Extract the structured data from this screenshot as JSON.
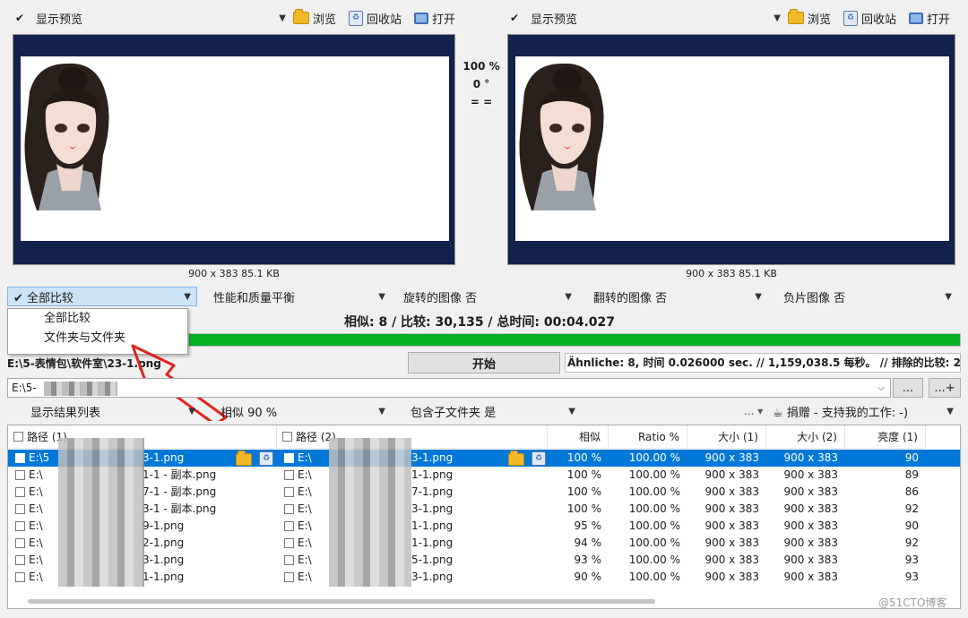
{
  "left_pane": {
    "mode_label": "显示预览",
    "browse_label": "浏览",
    "recycle_label": "回收站",
    "open_label": "打开",
    "caption": "900 x 383 85.1 KB"
  },
  "right_pane": {
    "mode_label": "显示预览",
    "browse_label": "浏览",
    "recycle_label": "回收站",
    "open_label": "打开",
    "caption": "900 x 383 85.1 KB"
  },
  "center_info": {
    "zoom": "100 %",
    "rotation": "0 °",
    "equal": "= ="
  },
  "options_bar": {
    "compare_mode": "全部比较",
    "performance": "性能和质量平衡",
    "rotated": "旋转的图像 否",
    "flipped": "翻转的图像 否",
    "negative": "负片图像 否"
  },
  "compare_menu": {
    "items": [
      "全部比较",
      "文件夹与文件夹"
    ]
  },
  "status": {
    "summary": "相似: 8 / 比较: 30,135 / 总时间: 00:04.027",
    "progress": 1.0
  },
  "action_row": {
    "current_file": "E:\\5-表情包\\软件室\\23-1.png",
    "start_label": "开始",
    "log": "Ähnliche: 8, 时间 0.026000 sec. // 1,159,038.5 每秒。 // 排除的比较: 2"
  },
  "path_bar": {
    "value": "E:\\5-",
    "btn1": "...",
    "btn2": "...+"
  },
  "results_bar": {
    "view": "显示结果列表",
    "similarity": "相似 90 %",
    "subfolders": "包含子文件夹 是",
    "more": "...",
    "donate": "捐赠 - 支持我的工作: -)"
  },
  "table": {
    "headers": [
      "路径 (1)",
      "路径 (2)",
      "相似",
      "Ratio %",
      "大小 (1)",
      "大小 (2)",
      "亮度 (1)"
    ],
    "rows": [
      {
        "p1": "E:\\5",
        "p1s": "3-1.png",
        "p2": "E:\\",
        "p2s": "3-1.png",
        "sim": "100 %",
        "ratio": "100.00 %",
        "s1": "900 x 383",
        "s2": "900 x 383",
        "bright": "90"
      },
      {
        "p1": "E:\\",
        "p1s": "1-1 - 副本.png",
        "p2": "E:\\",
        "p2s": "1-1.png",
        "sim": "100 %",
        "ratio": "100.00 %",
        "s1": "900 x 383",
        "s2": "900 x 383",
        "bright": "89"
      },
      {
        "p1": "E:\\",
        "p1s": "7-1 - 副本.png",
        "p2": "E:\\",
        "p2s": "7-1.png",
        "sim": "100 %",
        "ratio": "100.00 %",
        "s1": "900 x 383",
        "s2": "900 x 383",
        "bright": "86"
      },
      {
        "p1": "E:\\",
        "p1s": "3-1 - 副本.png",
        "p2": "E:\\",
        "p2s": "3-1.png",
        "sim": "100 %",
        "ratio": "100.00 %",
        "s1": "900 x 383",
        "s2": "900 x 383",
        "bright": "92"
      },
      {
        "p1": "E:\\",
        "p1s": "9-1.png",
        "p2": "E:\\",
        "p2s": "1-1.png",
        "sim": "95 %",
        "ratio": "100.00 %",
        "s1": "900 x 383",
        "s2": "900 x 383",
        "bright": "90"
      },
      {
        "p1": "E:\\",
        "p1s": "2-1.png",
        "p2": "E:\\",
        "p2s": "1-1.png",
        "sim": "94 %",
        "ratio": "100.00 %",
        "s1": "900 x 383",
        "s2": "900 x 383",
        "bright": "92"
      },
      {
        "p1": "E:\\",
        "p1s": "3-1.png",
        "p2": "E:\\",
        "p2s": "5-1.png",
        "sim": "93 %",
        "ratio": "100.00 %",
        "s1": "900 x 383",
        "s2": "900 x 383",
        "bright": "93"
      },
      {
        "p1": "E:\\",
        "p1s": "1-1.png",
        "p2": "E:\\",
        "p2s": "3-1.png",
        "sim": "90 %",
        "ratio": "100.00 %",
        "s1": "900 x 383",
        "s2": "900 x 383",
        "bright": "93"
      }
    ]
  },
  "watermark": "@51CTO博客",
  "colors": {
    "accent": "#0078d7",
    "progress": "#06b025",
    "preview_bg": "#13224c"
  }
}
